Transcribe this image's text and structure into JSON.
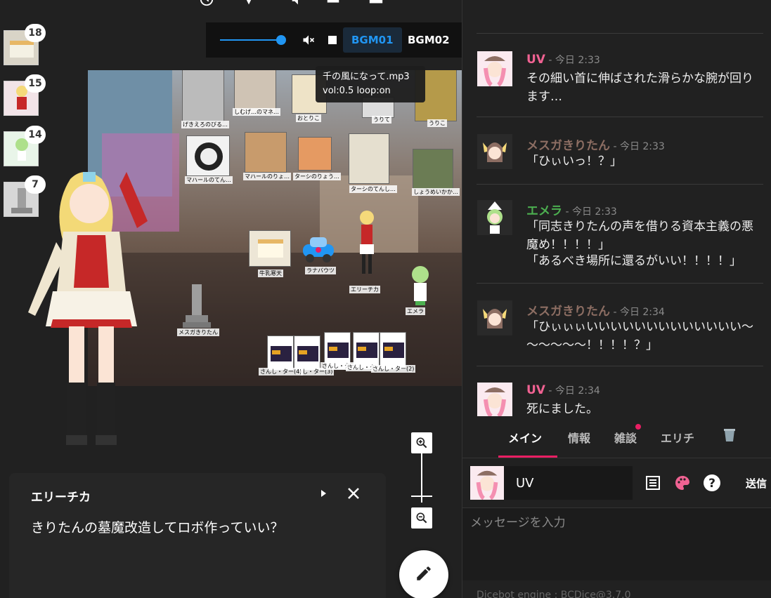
{
  "bgm": {
    "tabs": [
      "BGM01",
      "BGM02"
    ],
    "active_tab": "BGM01",
    "volume": 0.85,
    "tooltip_line1": "千の風になって.mp3",
    "tooltip_line2": "vol:0.5 loop:on"
  },
  "stack": [
    {
      "count": "18"
    },
    {
      "count": "15"
    },
    {
      "count": "14"
    },
    {
      "count": "7"
    }
  ],
  "map": {
    "pieces": [
      {
        "label": "げきえろのびる…"
      },
      {
        "label": "しむげ…のマネ…"
      },
      {
        "label": "おとりこ"
      },
      {
        "label": "うりて"
      },
      {
        "label": "うりこ"
      },
      {
        "label": "マハールのてん…"
      },
      {
        "label": "マハールのりょ…"
      },
      {
        "label": "ターシのりょう…"
      },
      {
        "label": "ターシのてんし…"
      },
      {
        "label": "しょうめいかか…"
      },
      {
        "label": "牛乳寒天"
      },
      {
        "label": "ラナバウツ"
      },
      {
        "label": "エリーチカ"
      },
      {
        "label": "エメラ"
      },
      {
        "label": "メスガきりたん"
      },
      {
        "label": "さんし・ター(4)"
      },
      {
        "label": "し・ター(3)"
      },
      {
        "label": "さんし・ター"
      },
      {
        "label": "さんし・タ"
      },
      {
        "label": "さんし・ター(2)"
      }
    ]
  },
  "dialog": {
    "speaker": "エリーチカ",
    "text": "きりたんの墓魔改造してロボ作っていい？"
  },
  "chat": {
    "messages": [
      {
        "name": "UV",
        "name_color": "#f06292",
        "time": " - 今日 2:33",
        "lines": [
          "その細い首に伸ばされた滑らかな腕が回ります…"
        ]
      },
      {
        "name": "メスガきりたん",
        "name_color": "#8d6e63",
        "time": " - 今日 2:33",
        "lines": [
          "「ひぃいっ！？」"
        ]
      },
      {
        "name": "エメラ",
        "name_color": "#4caf50",
        "time": " - 今日 2:33",
        "lines": [
          "「同志きりたんの声を借りる資本主義の悪魔め！！！！」",
          "「あるべき場所に還るがいい！！！！」"
        ]
      },
      {
        "name": "メスガきりたん",
        "name_color": "#8d6e63",
        "time": " - 今日 2:34",
        "lines": [
          "「ひぃぃぃいいいいいいいいいいいいい～～～～～～！！！！？」"
        ]
      },
      {
        "name": "UV",
        "name_color": "#f06292",
        "time": " - 今日 2:34",
        "lines": [
          "死にました。"
        ]
      }
    ],
    "tabs": [
      {
        "label": "メイン",
        "active": true
      },
      {
        "label": "情報",
        "active": false
      },
      {
        "label": "雑談",
        "active": false
      },
      {
        "label": "エリチ",
        "active": false
      }
    ],
    "composer": {
      "name": "UV",
      "send_label": "送信",
      "placeholder": "メッセージを入力"
    },
    "engine": "Dicebot engine : BCDice@3.7.0"
  },
  "colors": {
    "accent": "#2196f3",
    "tab_accent": "#e91e63",
    "palette_icon": "#f06292"
  },
  "icons": [
    "history-icon",
    "dice-icon",
    "volume-icon",
    "copy-icon",
    "window-icon",
    "record-icon",
    "mute-icon",
    "stop-icon",
    "play-icon",
    "close-icon",
    "zoom-in-icon",
    "zoom-out-icon",
    "edit-icon",
    "list-icon",
    "palette-icon",
    "help-icon",
    "trash-icon"
  ]
}
